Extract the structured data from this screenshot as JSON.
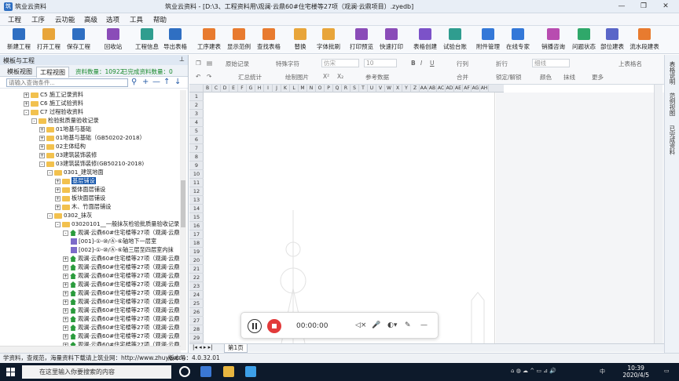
{
  "titlebar": {
    "app": "筑业云资料",
    "title": "筑业云资料 - [D:\\3、工程资料用\\观澜·云鼎60#住宅楼等27项（观澜·云鼎项目）.zyedb]"
  },
  "menu": [
    "工程",
    "工序",
    "云功能",
    "高级",
    "选项",
    "工具",
    "帮助"
  ],
  "toolbar": [
    "新建工程",
    "打开工程",
    "保存工程",
    "回收站",
    "工程信息",
    "导出表格",
    "工序建表",
    "显示范例",
    "查找表格",
    "替换",
    "字体批刷",
    "打印预览",
    "快速打印",
    "表格创建",
    "试验台账",
    "附件管理",
    "在线专家",
    "销播咨询",
    "问题状态",
    "部位建表",
    "流水段建表"
  ],
  "left": {
    "header": "模板与工程",
    "tabs": [
      "模板视图",
      "工程视图"
    ],
    "stat1": "资料数量：10922",
    "stat2": "已完成资料数量：0",
    "search_placeholder": "请输入查询条件..."
  },
  "tree": [
    {
      "t": "C5 施工记录资料",
      "lv": 3,
      "i": "folder",
      "e": "+"
    },
    {
      "t": "C6 施工试验资料",
      "lv": 3,
      "i": "folder",
      "e": "+"
    },
    {
      "t": "C7 过程验收资料",
      "lv": 3,
      "i": "folder",
      "e": "-"
    },
    {
      "t": "检验批质量验收记录",
      "lv": 4,
      "i": "folder",
      "e": "-"
    },
    {
      "t": "01地基与基础",
      "lv": 5,
      "i": "folder",
      "e": "+"
    },
    {
      "t": "01地基与基础（GB50202-2018）",
      "lv": 5,
      "i": "folder",
      "e": "+"
    },
    {
      "t": "02主体结构",
      "lv": 5,
      "i": "folder",
      "e": "+"
    },
    {
      "t": "03建筑装饰装修",
      "lv": 5,
      "i": "folder",
      "e": "+"
    },
    {
      "t": "03建筑装饰装修(GB50210-2018)",
      "lv": 5,
      "i": "folder",
      "e": "-"
    },
    {
      "t": "0301_建筑地面",
      "lv": 6,
      "i": "folder",
      "e": "-"
    },
    {
      "t": "基层铺设",
      "lv": 7,
      "i": "folder",
      "e": "+",
      "sel": true
    },
    {
      "t": "整体面层铺设",
      "lv": 7,
      "i": "folder",
      "e": "+"
    },
    {
      "t": "板块面层铺设",
      "lv": 7,
      "i": "folder",
      "e": "+"
    },
    {
      "t": "木、竹面层铺设",
      "lv": 7,
      "i": "folder",
      "e": "+"
    },
    {
      "t": "0302_抹灰",
      "lv": 6,
      "i": "folder",
      "e": "-"
    },
    {
      "t": "03020101__一般抹灰检验批质量验收记录",
      "lv": 7,
      "i": "folder",
      "e": "-"
    },
    {
      "t": "观澜·云鼎60#住宅楼等27项（观澜·云鼎6",
      "lv": 8,
      "i": "house",
      "e": "-"
    },
    {
      "t": "[001]-①-⑩/Ⓐ-⑥轴地下一层室",
      "lv": 9,
      "i": "doc",
      "e": ""
    },
    {
      "t": "[002]-①-⑩/Ⓐ-⑥轴三层至四层室内抹",
      "lv": 9,
      "i": "doc",
      "e": ""
    },
    {
      "t": "观澜·云鼎60#住宅楼等27项（观澜·云鼎6",
      "lv": 8,
      "i": "house",
      "e": "+"
    },
    {
      "t": "观澜·云鼎60#住宅楼等27项（观澜·云鼎6",
      "lv": 8,
      "i": "house",
      "e": "+"
    },
    {
      "t": "观澜·云鼎60#住宅楼等27项（观澜·云鼎6",
      "lv": 8,
      "i": "house",
      "e": "+"
    },
    {
      "t": "观澜·云鼎60#住宅楼等27项（观澜·云鼎6",
      "lv": 8,
      "i": "house",
      "e": "+"
    },
    {
      "t": "观澜·云鼎60#住宅楼等27项（观澜·云鼎6",
      "lv": 8,
      "i": "house",
      "e": "+"
    },
    {
      "t": "观澜·云鼎60#住宅楼等27项（观澜·云鼎6",
      "lv": 8,
      "i": "house",
      "e": "+"
    },
    {
      "t": "观澜·云鼎60#住宅楼等27项（观澜·云鼎6",
      "lv": 8,
      "i": "house",
      "e": "+"
    },
    {
      "t": "观澜·云鼎60#住宅楼等27项（观澜·云鼎6",
      "lv": 8,
      "i": "house",
      "e": "+"
    },
    {
      "t": "观澜·云鼎60#住宅楼等27项（观澜·云鼎6",
      "lv": 8,
      "i": "house",
      "e": "+"
    },
    {
      "t": "观澜·云鼎60#住宅楼等27项（观澜·云鼎6",
      "lv": 8,
      "i": "house",
      "e": "+"
    },
    {
      "t": "观澜·云鼎60#住宅楼等27项（观澜·云鼎6",
      "lv": 8,
      "i": "house",
      "e": "+"
    }
  ],
  "ribbon": {
    "r1": [
      "原始记录",
      "特殊字符",
      "仿宋",
      "10",
      "行列",
      "折行",
      "细线",
      "上表格名"
    ],
    "r2": [
      "汇总统计",
      "绘制图片",
      "参考数据",
      "合并",
      "锁定/解锁",
      "颜色",
      "抹线",
      "更多"
    ]
  },
  "columns": [
    "B",
    "C",
    "D",
    "E",
    "F",
    "G",
    "H",
    "I",
    "J",
    "K",
    "L",
    "M",
    "N",
    "O",
    "P",
    "Q",
    "R",
    "S",
    "T",
    "U",
    "V",
    "W",
    "X",
    "Y",
    "Z",
    "AA",
    "AB",
    "AC",
    "AD",
    "AE",
    "AF",
    "AG",
    "AH"
  ],
  "rows": [
    "1",
    "2",
    "3",
    "4",
    "5",
    "6",
    "7",
    "8",
    "9",
    "10",
    "11",
    "12",
    "13",
    "14",
    "15",
    "16",
    "17",
    "18",
    "19",
    "20",
    "21",
    "22",
    "23",
    "24",
    "25",
    "26",
    "27",
    "28",
    "29"
  ],
  "sheet_tab": "第1页",
  "right_strip": [
    "表格说明",
    "范例视图",
    "已完成资料"
  ],
  "recorder": {
    "time": "00:00:00"
  },
  "status": {
    "text": "学资料，查规范，海量资料下载请上筑业网：http://www.zhuyew.cn",
    "version": "版本号：4.0.32.01"
  },
  "taskbar": {
    "search": "在这里输入你要搜索的内容",
    "time": "10:39",
    "date": "2020/4/5",
    "ime": "中"
  },
  "colors": {
    "accent": "#2f6fc2",
    "selected": "#0b4fa8",
    "stat": "#1a8a2e"
  }
}
